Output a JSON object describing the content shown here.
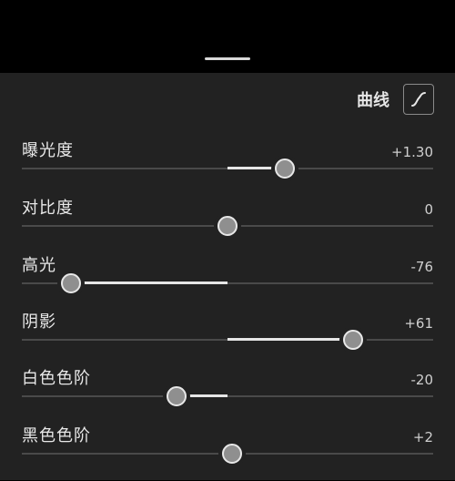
{
  "header": {
    "curve_label": "曲线",
    "curve_icon": "tone-curve-icon"
  },
  "sliders": [
    {
      "label": "曝光度",
      "value": "+1.30",
      "level": 0.64
    },
    {
      "label": "对比度",
      "value": "0",
      "level": 0.5
    },
    {
      "label": "高光",
      "value": "-76",
      "level": 0.12
    },
    {
      "label": "阴影",
      "value": "+61",
      "level": 0.805
    },
    {
      "label": "白色色阶",
      "value": "-20",
      "level": 0.375
    },
    {
      "label": "黑色色阶",
      "value": "+2",
      "level": 0.51
    }
  ],
  "colors": {
    "background": "#222222",
    "track": "#4a4a4a",
    "fill": "#e6e6e6"
  }
}
